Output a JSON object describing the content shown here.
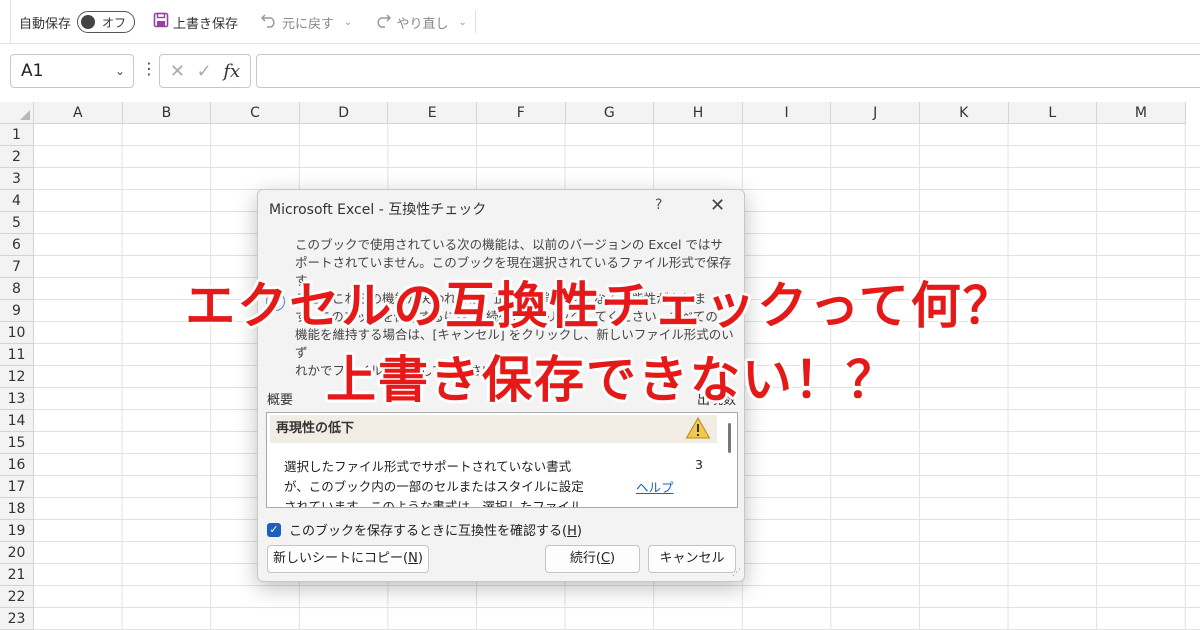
{
  "toolbar": {
    "autosave_label": "自動保存",
    "toggle_label": "オフ",
    "save_label": "上書き保存",
    "undo_label": "元に戻す",
    "redo_label": "やり直し"
  },
  "formula_bar": {
    "name_box": "A1",
    "fx_label": "fx",
    "formula": ""
  },
  "sheet": {
    "columns": [
      "A",
      "B",
      "C",
      "D",
      "E",
      "F",
      "G",
      "H",
      "I",
      "J",
      "K",
      "L",
      "M"
    ],
    "rows": [
      "1",
      "2",
      "3",
      "4",
      "5",
      "6",
      "7",
      "8",
      "9",
      "10",
      "11",
      "12",
      "13",
      "14",
      "15",
      "16",
      "17",
      "18",
      "19",
      "20",
      "21",
      "22",
      "23"
    ]
  },
  "dialog": {
    "title": "Microsoft Excel - 互換性チェック",
    "help": "?",
    "message_lines": [
      "このブックで使用されている次の機能は、以前のバージョンの Excel ではサ",
      "ポートされていません。このブックを現在選択されているファイル形式で保存す",
      "ると、これらの機能が失われるか、正しく機能しなくなる可能性がありま",
      "す。このブックを保存するには、[続行] をクリックしてください。すべての",
      "機能を維持する場合は、[キャンセル] をクリックし、新しいファイル形式のいず",
      "れかでファイルを保存してください。"
    ],
    "summary_label": "概要",
    "count_label": "出現数",
    "issue": {
      "heading": "再現性の低下",
      "description_lines": [
        "選択したファイル形式でサポートされていない書式",
        "が、このブック内の一部のセルまたはスタイルに設定",
        "されています。このような書式は、選択したファイル"
      ],
      "count": "3",
      "link": "ヘルプ"
    },
    "checkbox_label": "このブックを保存するときに互換性を確認する(",
    "checkbox_key": "H",
    "copy_button": "新しいシートにコピー(",
    "copy_key": "N",
    "continue_button": "続行(",
    "continue_key": "C",
    "cancel_button": "キャンセル",
    "close_paren": ")"
  },
  "overlay": {
    "line1": "エクセルの互換性チェックって何？",
    "line2": "上書き保存できない！？"
  },
  "colors": {
    "overlay_text": "#e61919",
    "accent_blue": "#1c5fbf",
    "save_icon": "#9b3fa5"
  }
}
